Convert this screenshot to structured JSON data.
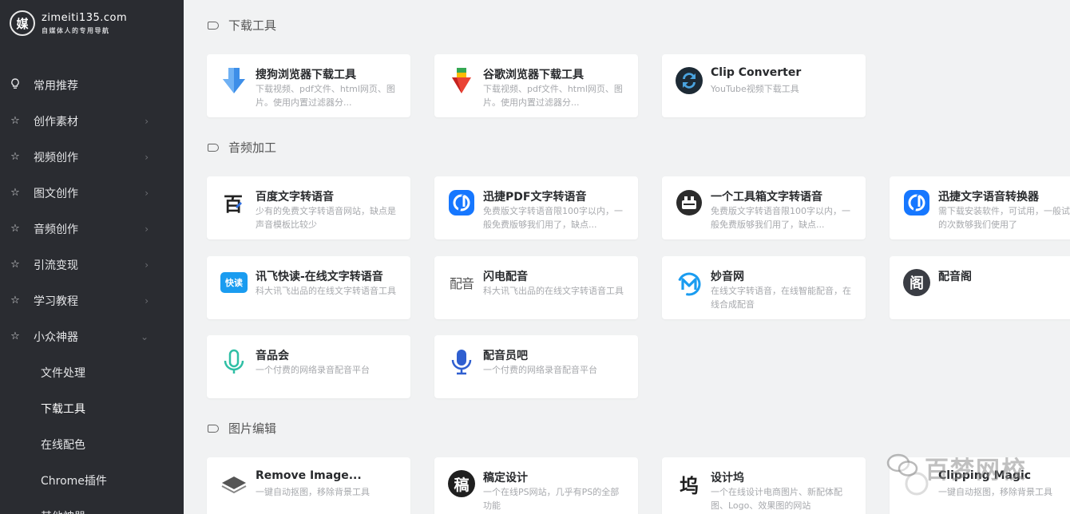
{
  "site": {
    "logo_char": "媒",
    "domain": "zimeiti135.com",
    "slogan": "自媒体人的专用导航"
  },
  "menu": [
    {
      "label": "常用推荐",
      "icon": "bulb-icon",
      "arrow": ""
    },
    {
      "label": "创作素材",
      "icon": "star-icon",
      "arrow": "›"
    },
    {
      "label": "视频创作",
      "icon": "star-icon",
      "arrow": "›"
    },
    {
      "label": "图文创作",
      "icon": "star-icon",
      "arrow": "›"
    },
    {
      "label": "音频创作",
      "icon": "star-icon",
      "arrow": "›"
    },
    {
      "label": "引流变现",
      "icon": "star-icon",
      "arrow": "›"
    },
    {
      "label": "学习教程",
      "icon": "star-icon",
      "arrow": "›"
    },
    {
      "label": "小众神器",
      "icon": "star-icon",
      "arrow": "⌄"
    }
  ],
  "submenu": [
    "文件处理",
    "下载工具",
    "在线配色",
    "Chrome插件",
    "其他神器"
  ],
  "sections": {
    "download": "下载工具",
    "audio": "音频加工",
    "image": "图片编辑"
  },
  "cards": {
    "sogou": {
      "title": "搜狗浏览器下载工具",
      "desc": "下载视频、pdf文件、html网页、图片。使用内置过滤器分..."
    },
    "google": {
      "title": "谷歌浏览器下载工具",
      "desc": "下载视频、pdf文件、html网页、图片。使用内置过滤器分..."
    },
    "clip": {
      "title": "Clip Converter",
      "desc": "YouTube视频下载工具"
    },
    "baidu_tts": {
      "title": "百度文字转语音",
      "desc": "少有的免费文字转语音网站，缺点是声音模板比较少"
    },
    "xunjie_pdf": {
      "title": "迅捷PDF文字转语音",
      "desc": "免费版文字转语音限100字以内，一般免费版够我们用了，缺点..."
    },
    "toolbox_tts": {
      "title": "一个工具箱文字转语音",
      "desc": "免费版文字转语音限100字以内，一般免费版够我们用了，缺点..."
    },
    "xunjie_conv": {
      "title": "迅捷文字语音转换器",
      "desc": "需下载安装软件，可试用，一般试用的次数够我们使用了"
    },
    "xunfei": {
      "title": "讯飞快读-在线文字转语音",
      "desc": "科大讯飞出品的在线文字转语音工具",
      "icon_text": "快读"
    },
    "shandian": {
      "title": "闪电配音",
      "desc": "科大讯飞出品的在线文字转语音工具",
      "icon_text": "配音"
    },
    "miaoyin": {
      "title": "妙音网",
      "desc": "在线文字转语音，在线智能配音，在线合成配音"
    },
    "peiyinge": {
      "title": "配音阁",
      "desc": "",
      "icon_text": "阁"
    },
    "yinpinhui": {
      "title": "音品会",
      "desc": "一个付费的网络录音配音平台"
    },
    "peiyinyuan": {
      "title": "配音员吧",
      "desc": "一个付费的网络录音配音平台"
    },
    "remove": {
      "title": "Remove Image...",
      "desc": "一键自动抠图，移除背景工具"
    },
    "gaoding": {
      "title": "稿定设计",
      "desc": "一个在线PS网站，几乎有PS的全部功能",
      "icon_text": "稿"
    },
    "sheji": {
      "title": "设计坞",
      "desc": "一个在线设计电商图片、新配体配图、Logo、效果图的网站",
      "icon_text": "坞"
    },
    "clipping": {
      "title": "Clipping Magic",
      "desc": "一键自动抠图，移除背景工具"
    }
  },
  "watermark": {
    "text": "百梦网校"
  },
  "colors": {
    "sidebar_bg": "#2a2c31",
    "page_bg": "#f1f2f3",
    "blue": "#1677ff",
    "teal": "#2fbfa5"
  }
}
